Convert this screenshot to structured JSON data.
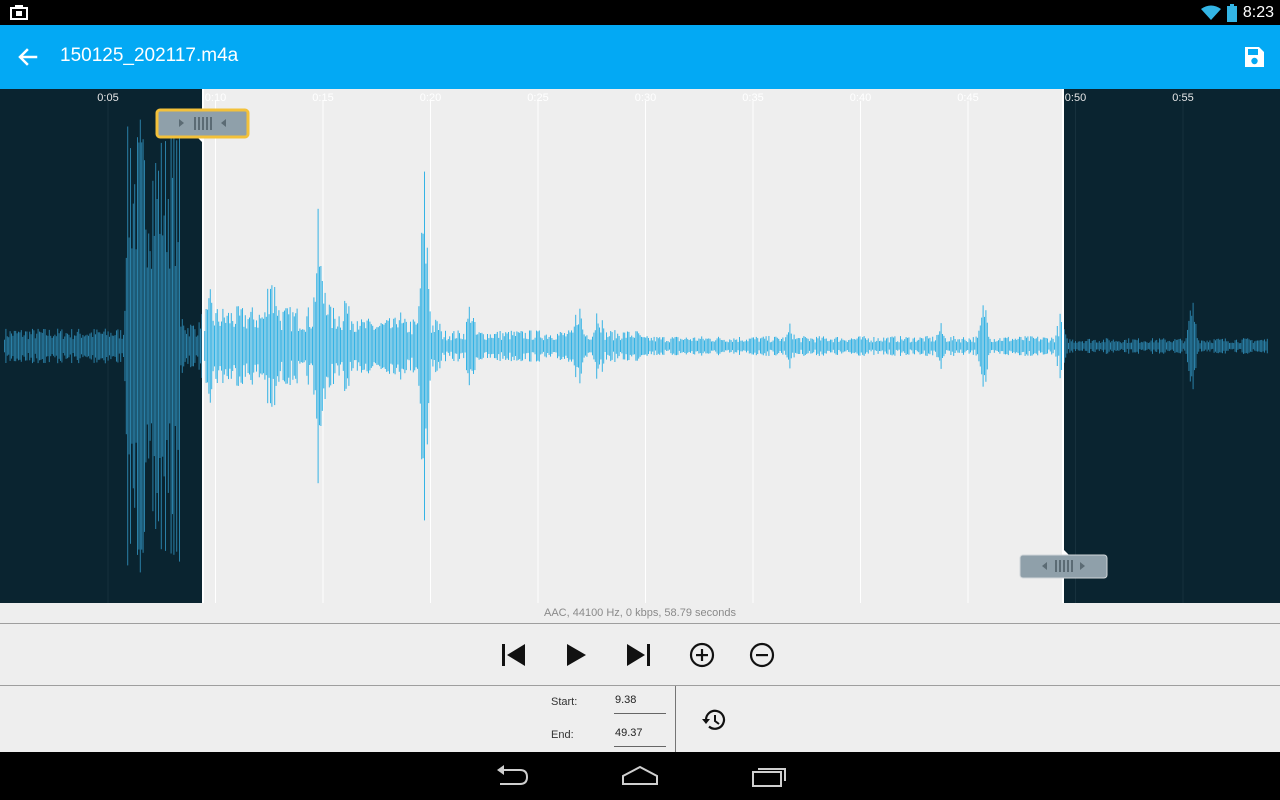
{
  "status_bar": {
    "time": "8:23",
    "left_icon": "notification-icon",
    "wifi_icon": "wifi-icon",
    "battery_icon": "battery-icon"
  },
  "app_bar": {
    "title": "150125_202117.m4a",
    "back_icon": "arrow-back-icon",
    "save_icon": "save-icon",
    "color": "#03a9f4"
  },
  "waveform": {
    "time_labels": [
      "0:05",
      "0:10",
      "0:15",
      "0:20",
      "0:25",
      "0:30",
      "0:35",
      "0:40",
      "0:45",
      "0:50",
      "0:55"
    ],
    "selection_start_sec": 9.38,
    "selection_end_sec": 49.37,
    "wave_color": "#35b3e5",
    "selected_bg": "#eeeeee",
    "unselected_bg": "#0a2430",
    "handle_highlight": "#f3c13a"
  },
  "file_info": "AAC, 44100 Hz, 0 kbps, 58.79 seconds",
  "controls": {
    "prev_icon": "skip-previous-icon",
    "play_icon": "play-icon",
    "next_icon": "skip-next-icon",
    "zoom_in_icon": "zoom-in-icon",
    "zoom_out_icon": "zoom-out-icon"
  },
  "trim": {
    "start_label": "Start:",
    "start_value": "9.38",
    "end_label": "End:",
    "end_value": "49.37",
    "reset_icon": "restore-icon"
  },
  "nav": {
    "back_icon": "nav-back-icon",
    "home_icon": "nav-home-icon",
    "recents_icon": "nav-recents-icon"
  }
}
